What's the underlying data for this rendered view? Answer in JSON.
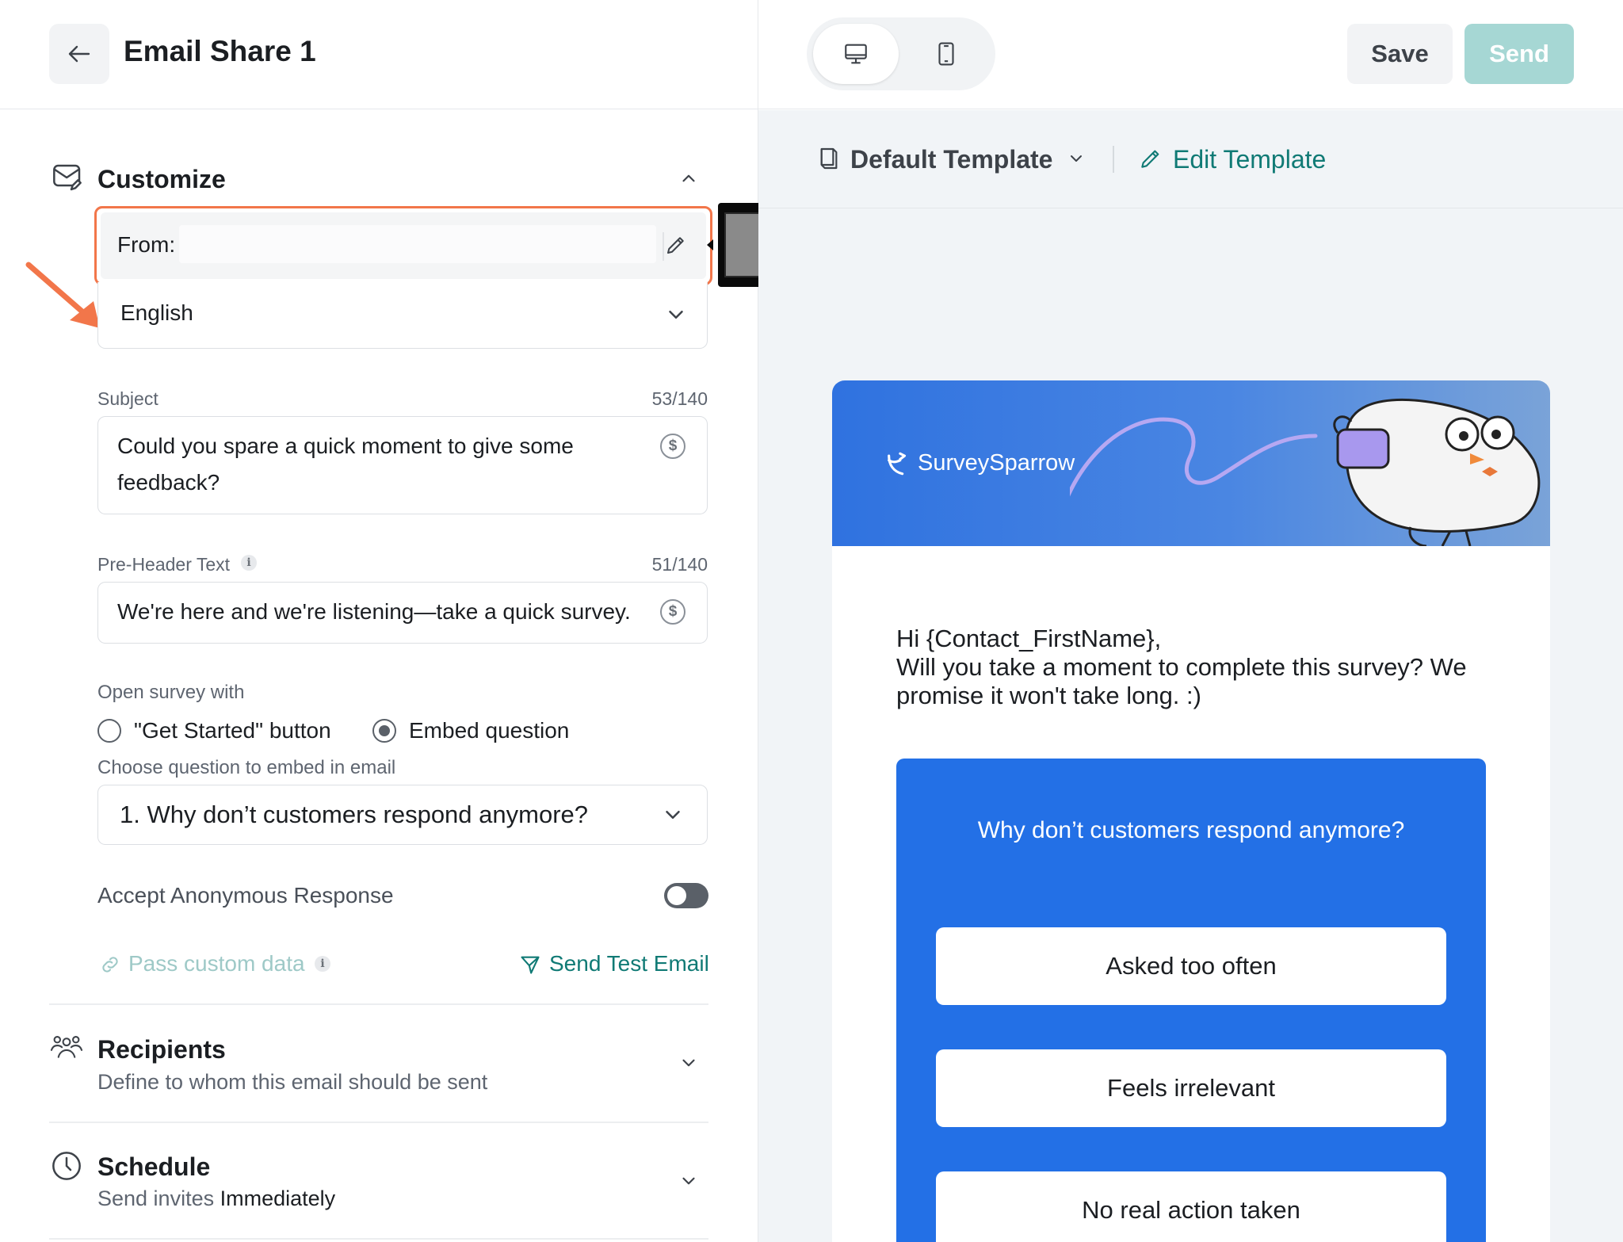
{
  "header": {
    "title": "Email Share 1",
    "save_label": "Save",
    "send_label": "Send"
  },
  "customize": {
    "title": "Customize",
    "from_label": "From:",
    "language": "English",
    "subject": {
      "label": "Subject",
      "counter": "53/140",
      "value": "Could you spare a quick moment to give some feedback?"
    },
    "preheader": {
      "label": "Pre-Header Text",
      "counter": "51/140",
      "value": "We're here and we're listening—take a quick survey."
    },
    "open_survey": {
      "label": "Open survey with",
      "option_1": "\"Get Started\" button",
      "option_2": "Embed question",
      "selected": "Embed question"
    },
    "embed_question": {
      "label": "Choose question to embed in email",
      "value": "1. Why don’t customers respond anymore?"
    },
    "anonymous": {
      "label": "Accept Anonymous Response",
      "enabled": false
    },
    "pass_custom_data": "Pass custom data",
    "send_test_email": "Send Test Email"
  },
  "recipients": {
    "title": "Recipients",
    "subtitle": "Define to whom this email should be sent"
  },
  "schedule": {
    "title": "Schedule",
    "subtitle_prefix": "Send invites",
    "subtitle_value": "Immediately"
  },
  "preview": {
    "template_name": "Default Template",
    "edit_template": "Edit Template",
    "brand": "SurveySparrow",
    "greeting": "Hi {Contact_FirstName},",
    "message": "Will you take a moment to complete this survey? We promise it won't take long. :)",
    "question": "Why don’t customers respond anymore?",
    "options": [
      "Asked too often",
      "Feels irrelevant",
      "No real action taken"
    ]
  },
  "colors": {
    "accent_teal": "#107a75",
    "send_disabled": "#a6d7d4",
    "highlight_orange": "#f2764a",
    "question_blue": "#2370e6"
  }
}
